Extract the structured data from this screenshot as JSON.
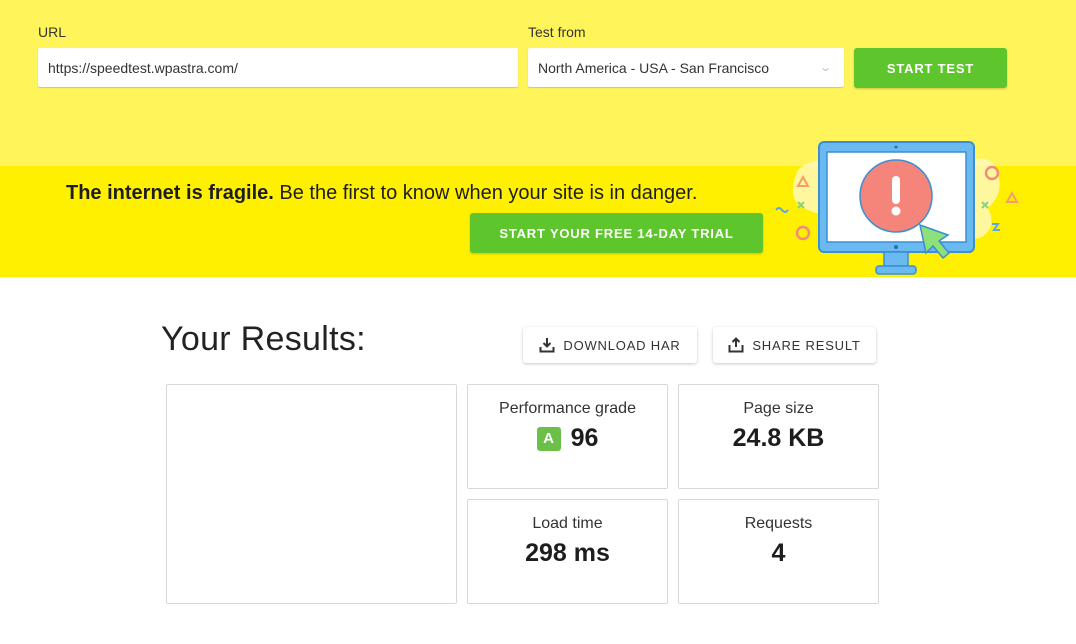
{
  "form": {
    "url_label": "URL",
    "url_value": "https://speedtest.wpastra.com/",
    "test_from_label": "Test from",
    "test_from_value": "North America - USA - San Francisco",
    "start_test_label": "START TEST"
  },
  "banner": {
    "tagline_bold": "The internet is fragile.",
    "tagline_rest": " Be the first to know when your site is in danger.",
    "trial_button_label": "START YOUR FREE 14-DAY TRIAL",
    "illustration": "monitor-alert-icon"
  },
  "results": {
    "title": "Your Results:",
    "download_har_label": "DOWNLOAD HAR",
    "share_result_label": "SHARE RESULT",
    "metrics": [
      {
        "title": "Performance grade",
        "grade": "A",
        "value": "96"
      },
      {
        "title": "Page size",
        "value": "24.8 KB"
      },
      {
        "title": "Load time",
        "value": "298 ms"
      },
      {
        "title": "Requests",
        "value": "4"
      }
    ]
  },
  "colors": {
    "top_bg": "#fff55a",
    "banner_bg": "#fff000",
    "accent_green": "#5ec62c",
    "grade_green": "#6cc04a"
  }
}
